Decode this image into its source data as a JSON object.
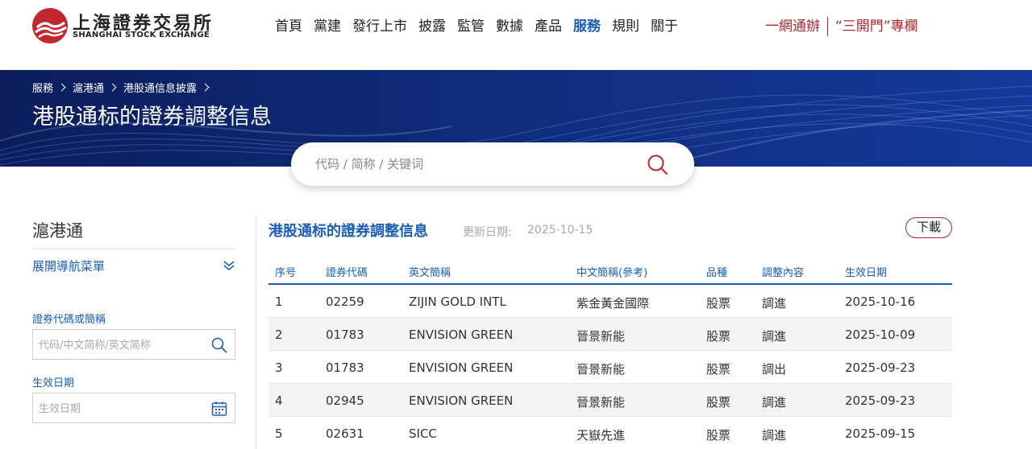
{
  "brand": {
    "name_cn": "上海證券交易所",
    "name_en": "SHANGHAI STOCK EXCHANGE",
    "color_red": "#c1272d",
    "color_blue": "#1a5eb8"
  },
  "nav": {
    "items": [
      {
        "label": "首頁"
      },
      {
        "label": "黨建"
      },
      {
        "label": "發行上市"
      },
      {
        "label": "披露"
      },
      {
        "label": "監管"
      },
      {
        "label": "數據"
      },
      {
        "label": "產品"
      },
      {
        "label": "服務",
        "active": true
      },
      {
        "label": "規則"
      },
      {
        "label": "關于"
      }
    ]
  },
  "utility": {
    "one_stop": "一網通辦",
    "column": "“三開門”專欄"
  },
  "banner": {
    "breadcrumb": [
      "服務",
      "滬港通",
      "港股通信息披露"
    ],
    "title": "港股通标的證券調整信息"
  },
  "search": {
    "placeholder": "代码 / 简称 / 关键词",
    "icon": "search-icon"
  },
  "sidebar": {
    "title": "滬港通",
    "expand_label": "展開導航菜單",
    "code_label": "證券代碼或簡稱",
    "code_placeholder": "代码/中文简称/英文简称",
    "date_label": "生效日期",
    "date_placeholder": "生效日期"
  },
  "main": {
    "title": "港股通标的證券調整信息",
    "update_label": "更新日期:",
    "update_date": "2025-10-15",
    "download_label": "下載",
    "columns": [
      "序号",
      "證券代碼",
      "英文簡稱",
      "中文簡稱(參考)",
      "品種",
      "調整內容",
      "生效日期"
    ],
    "rows": [
      {
        "no": "1",
        "code": "02259",
        "en": "ZIJIN GOLD INTL",
        "cn": "紫金黃金國際",
        "type": "股票",
        "adj": "調進",
        "date": "2025-10-16"
      },
      {
        "no": "2",
        "code": "01783",
        "en": "ENVISION GREEN",
        "cn": "晉景新能",
        "type": "股票",
        "adj": "調進",
        "date": "2025-10-09"
      },
      {
        "no": "3",
        "code": "01783",
        "en": "ENVISION GREEN",
        "cn": "晉景新能",
        "type": "股票",
        "adj": "調出",
        "date": "2025-09-23"
      },
      {
        "no": "4",
        "code": "02945",
        "en": "ENVISION GREEN",
        "cn": "晉景新能",
        "type": "股票",
        "adj": "調進",
        "date": "2025-09-23"
      },
      {
        "no": "5",
        "code": "02631",
        "en": "SICC",
        "cn": "天嶽先進",
        "type": "股票",
        "adj": "調進",
        "date": "2025-09-15"
      }
    ]
  }
}
